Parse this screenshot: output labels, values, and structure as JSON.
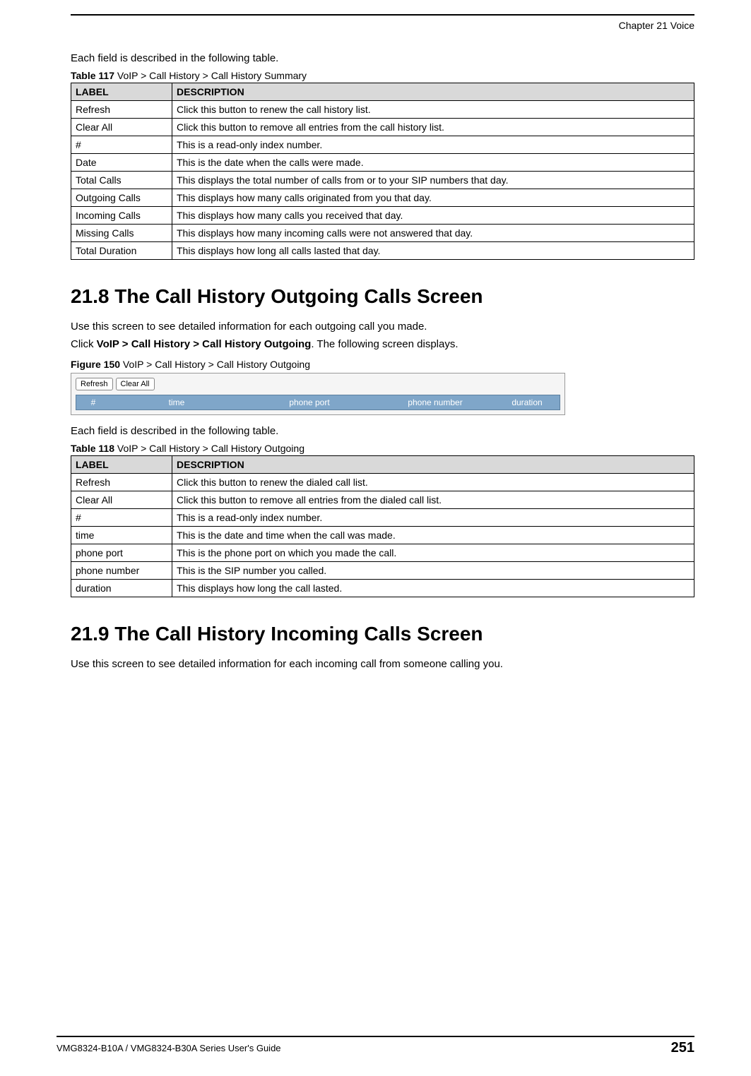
{
  "chapter_header": "Chapter 21 Voice",
  "intro_text_1": "Each field is described in the following table.",
  "table117": {
    "caption_bold": "Table 117",
    "caption_rest": "   VoIP >  Call History >  Call History Summary",
    "header_label": "LABEL",
    "header_desc": "DESCRIPTION",
    "rows": [
      {
        "label": "Refresh",
        "desc": "Click this button to renew the call history list."
      },
      {
        "label": "Clear All",
        "desc": "Click this button to remove all entries from the call history list."
      },
      {
        "label": "#",
        "desc": "This is a read-only index number."
      },
      {
        "label": "Date",
        "desc": "This is the date when the calls were made."
      },
      {
        "label": "Total Calls",
        "desc": "This displays the total number of calls from or to your SIP numbers that day."
      },
      {
        "label": "Outgoing Calls",
        "desc": "This displays how many calls originated from you that day."
      },
      {
        "label": "Incoming Calls",
        "desc": "This displays how many calls you received that day."
      },
      {
        "label": "Missing Calls",
        "desc": "This displays how many incoming calls were not answered that day."
      },
      {
        "label": "Total Duration",
        "desc": "This displays how long all calls lasted that day."
      }
    ]
  },
  "section_21_8": {
    "title": "21.8  The Call History Outgoing Calls Screen",
    "p1": "Use this screen to see detailed information for each outgoing call you made.",
    "p2_pre": "Click ",
    "p2_bold": "VoIP >  Call History >  Call History Outgoing",
    "p2_post": ". The following screen displays.",
    "fig_caption_bold": "Figure 150",
    "fig_caption_rest": "   VoIP >  Call History >  Call History Outgoing"
  },
  "screenshot": {
    "refresh": "Refresh",
    "clear_all": "Clear All",
    "col_hash": "#",
    "col_time": "time",
    "col_port": "phone port",
    "col_number": "phone number",
    "col_duration": "duration"
  },
  "intro_text_2": "Each field is described in the following table.",
  "table118": {
    "caption_bold": "Table 118",
    "caption_rest": "   VoIP >  Call History >  Call History Outgoing",
    "header_label": "LABEL",
    "header_desc": "DESCRIPTION",
    "rows": [
      {
        "label": "Refresh",
        "desc": "Click this button to renew the dialed call list."
      },
      {
        "label": "Clear All",
        "desc": "Click this button to remove all entries from the dialed call list."
      },
      {
        "label": "#",
        "desc": "This is a read-only index number."
      },
      {
        "label": "time",
        "desc": "This is the date and time when the call was made."
      },
      {
        "label": "phone port",
        "desc": "This is the phone port on which you made the call."
      },
      {
        "label": "phone number",
        "desc": "This is the SIP number you called."
      },
      {
        "label": "duration",
        "desc": "This displays how long the call lasted."
      }
    ]
  },
  "section_21_9": {
    "title": "21.9  The Call History Incoming Calls Screen",
    "p1": "Use this screen to see detailed information for each incoming call from someone calling you."
  },
  "footer_left": "VMG8324-B10A / VMG8324-B30A Series User's Guide",
  "footer_right": "251"
}
